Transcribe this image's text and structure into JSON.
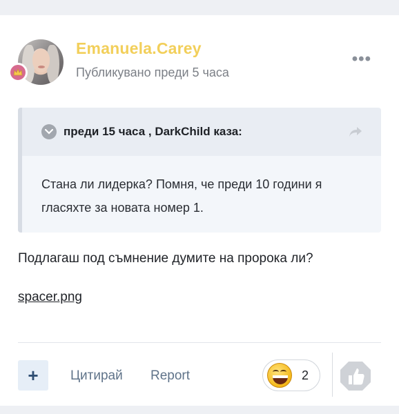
{
  "post": {
    "username": "Emanuela.Carey",
    "meta": "Публикувано преди 5 часа",
    "more_icon": "more-horizontal-icon",
    "quote": {
      "header": "преди 15 часа , DarkChild каза:",
      "body": "Стана ли лидерка? Помня, че преди 10 години я гласяхте за новата номер 1."
    },
    "text": "Подлагаш под съмнение думите на пророка ли?",
    "attachment": "spacer.png"
  },
  "footer": {
    "plus_label": "+",
    "quote_label": "Цитирай",
    "report_label": "Report",
    "reaction_count": "2"
  },
  "colors": {
    "username": "#f2cf5a",
    "badge": "#d76a8e",
    "link": "#5f7389"
  }
}
